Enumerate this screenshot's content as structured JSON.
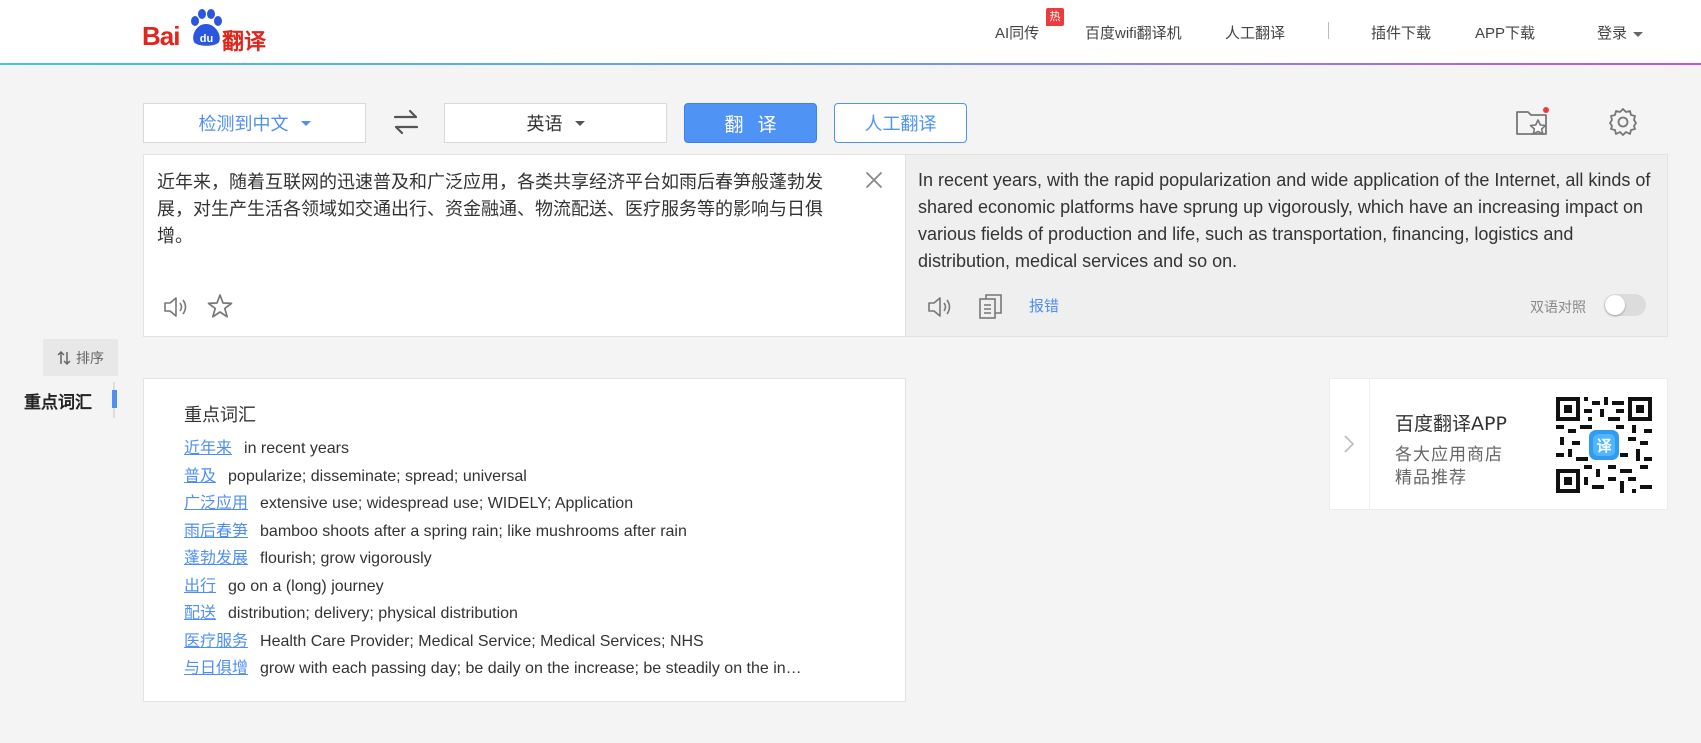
{
  "header": {
    "logo": {
      "text_bai": "Bai",
      "text_du": "du",
      "text_fanyi": "翻译"
    },
    "nav": [
      {
        "label": "AI同传",
        "badge": "热"
      },
      {
        "label": "百度wifi翻译机"
      },
      {
        "label": "人工翻译"
      },
      {
        "label": "插件下载"
      },
      {
        "label": "APP下载"
      }
    ],
    "login_label": "登录",
    "accent_gradient": [
      "#3bc8e0",
      "#c155d6"
    ]
  },
  "toolbar": {
    "source_lang": "检测到中文",
    "target_lang": "英语",
    "translate_label": "翻译",
    "human_translate_label": "人工翻译",
    "swap_icon": "swap-arrows-icon",
    "favorites_icon": "folder-star-icon",
    "settings_icon": "gear-icon"
  },
  "source": {
    "text": "近年来，随着互联网的迅速普及和广泛应用，各类共享经济平台如雨后春笋般蓬勃发展，对生产生活各领域如交通出行、资金融通、物流配送、医疗服务等的影响与日俱增。"
  },
  "target": {
    "text": "In recent years, with the rapid popularization and wide application of the Internet, all kinds of shared economic platforms have sprung up vigorously, which have an increasing impact on various fields of production and life, such as transportation, financing, logistics and distribution, medical services and so on.",
    "report_label": "报错",
    "bilingual_label": "双语对照",
    "bilingual_on": false
  },
  "sidebar": {
    "sort_label": "排序",
    "section_label": "重点词汇"
  },
  "vocab": {
    "title": "重点词汇",
    "items": [
      {
        "word": "近年来",
        "def": "in recent years"
      },
      {
        "word": "普及",
        "def": "popularize; disseminate; spread; universal"
      },
      {
        "word": "广泛应用",
        "def": "extensive use; widespread use; WIDELY; Application"
      },
      {
        "word": "雨后春笋",
        "def": "bamboo shoots after a spring rain; like mushrooms after rain"
      },
      {
        "word": "蓬勃发展",
        "def": "flourish; grow vigorously"
      },
      {
        "word": "出行",
        "def": "go on a (long) journey"
      },
      {
        "word": "配送",
        "def": "distribution; delivery; physical distribution"
      },
      {
        "word": "医疗服务",
        "def": "Health Care Provider; Medical Service; Medical Services; NHS"
      },
      {
        "word": "与日俱增",
        "def": "grow with each passing day; be daily on the increase; be steadily on the in…"
      }
    ]
  },
  "app_promo": {
    "title": "百度翻译APP",
    "line1": "各大应用商店",
    "line2": "精品推荐",
    "qr_center_glyph": "译"
  }
}
